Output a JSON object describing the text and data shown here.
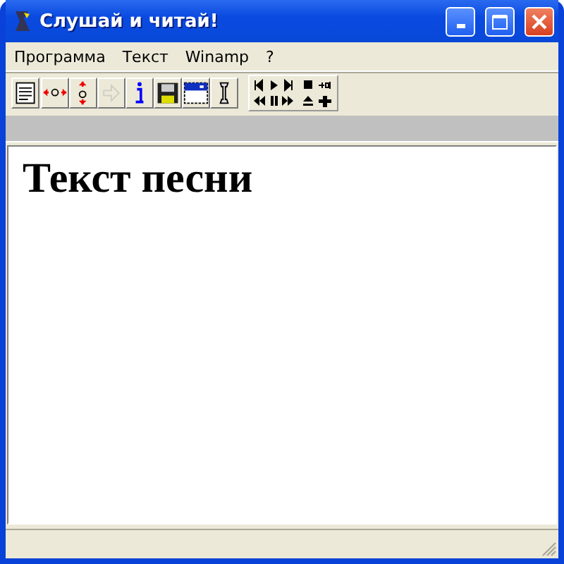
{
  "window": {
    "title": "Слушай и читай!"
  },
  "menu": [
    {
      "label": "Программа"
    },
    {
      "label": "Текст"
    },
    {
      "label": "Winamp"
    },
    {
      "label": "?"
    }
  ],
  "toolbar": [
    {
      "kind": "document",
      "disabled": false
    },
    {
      "kind": "widen",
      "disabled": false
    },
    {
      "kind": "heighten",
      "disabled": false
    },
    {
      "kind": "next-arrow",
      "disabled": true
    },
    {
      "kind": "info",
      "disabled": false
    },
    {
      "kind": "save",
      "disabled": false
    },
    {
      "kind": "window",
      "disabled": false
    },
    {
      "kind": "wrench",
      "disabled": false
    }
  ],
  "player": [
    {
      "kind": "prev"
    },
    {
      "kind": "play"
    },
    {
      "kind": "next"
    },
    {
      "kind": "stop"
    },
    {
      "kind": "volume"
    },
    {
      "kind": "rewind"
    },
    {
      "kind": "pause"
    },
    {
      "kind": "forward"
    },
    {
      "kind": "eject"
    },
    {
      "kind": "plus"
    }
  ],
  "content": {
    "heading": "Текст песни"
  }
}
